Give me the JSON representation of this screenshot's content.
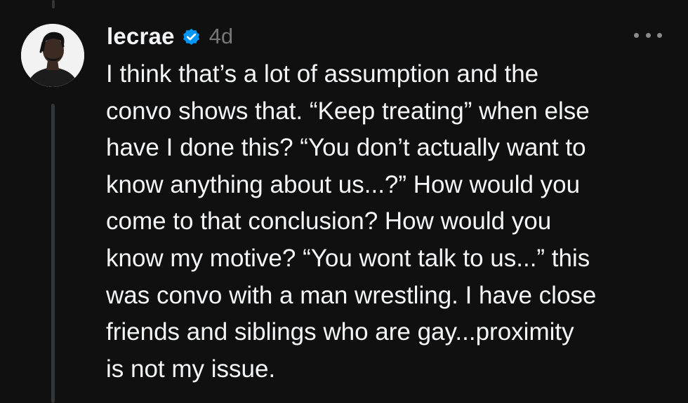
{
  "post": {
    "username": "lecrae",
    "timestamp": "4d",
    "verified": true,
    "lines": [
      "I think that’s a lot of assumption and the",
      "convo shows that. “Keep treating” when else",
      "have I done this? “You don’t actually want to",
      "know anything about us...?” How would you",
      "come to that conclusion? How would you",
      "know my motive? “You wont talk to us...” this",
      "was convo with a man wrestling. I have close",
      "friends and siblings who are gay...proximity",
      "is not my issue."
    ]
  },
  "icons": {
    "verified": "verified-badge-icon",
    "more": "more-options-icon"
  },
  "colors": {
    "background": "#101010",
    "text": "#f3f5f7",
    "muted": "#777777",
    "verified": "#0095f6",
    "thread_line": "#333638"
  }
}
